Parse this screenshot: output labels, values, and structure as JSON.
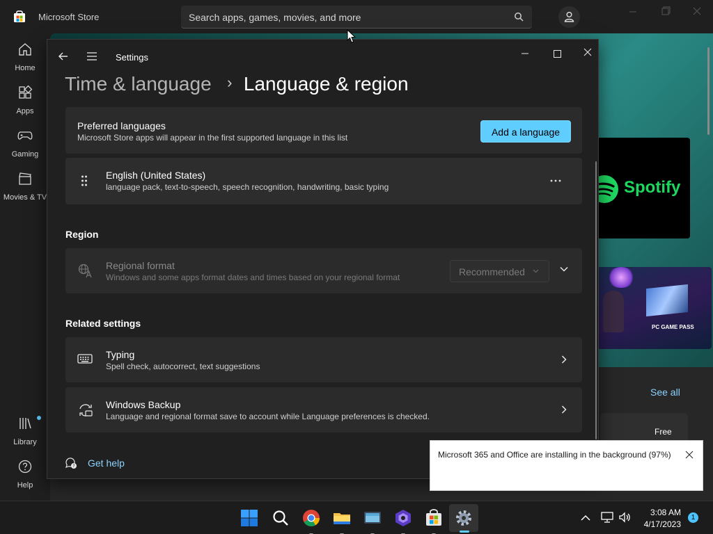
{
  "store": {
    "title": "Microsoft Store",
    "search_placeholder": "Search apps, games, movies, and more",
    "nav": [
      {
        "label": "Home",
        "icon": "home-icon"
      },
      {
        "label": "Apps",
        "icon": "apps-icon"
      },
      {
        "label": "Gaming",
        "icon": "gaming-icon"
      },
      {
        "label": "Movies & TV",
        "icon": "movies-icon"
      },
      {
        "label": "Library",
        "icon": "library-icon"
      },
      {
        "label": "Help",
        "icon": "help-icon"
      }
    ],
    "spotify_label": "Spotify",
    "gamepass_label": "PC GAME PASS",
    "see_all": "See all",
    "free_label": "Free"
  },
  "settings": {
    "window_title": "Settings",
    "breadcrumb": {
      "parent": "Time & language",
      "separator": "›",
      "current": "Language & region"
    },
    "preferred": {
      "title": "Preferred languages",
      "desc": "Microsoft Store apps will appear in the first supported language in this list",
      "add_button": "Add a language"
    },
    "english": {
      "title": "English (United States)",
      "desc": "language pack, text-to-speech, speech recognition, handwriting, basic typing"
    },
    "region": {
      "heading": "Region",
      "title": "Regional format",
      "desc": "Windows and some apps format dates and times based on your regional format",
      "dropdown_value": "Recommended"
    },
    "related": {
      "heading": "Related settings",
      "typing": {
        "title": "Typing",
        "desc": "Spell check, autocorrect, text suggestions"
      },
      "backup": {
        "title": "Windows Backup",
        "desc": "Language and regional format save to account while Language preferences is checked."
      }
    },
    "get_help": "Get help"
  },
  "toast": {
    "message": "Microsoft 365 and Office are installing in the background (97%)"
  },
  "taskbar": {
    "time": "3:08 AM",
    "date": "4/17/2023",
    "notification_count": "1"
  },
  "colors": {
    "accent": "#60cdff",
    "link": "#8cd2ff",
    "spotify_green": "#1ed760"
  }
}
